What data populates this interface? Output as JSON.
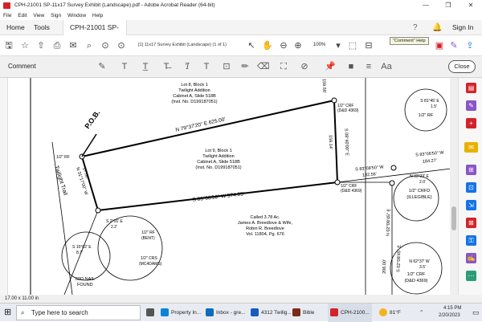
{
  "window": {
    "title": "CPH-21001 SP-11x17 Survey Exhibit (Landscape).pdf - Adobe Acrobat Reader (64-bit)",
    "minimize": "—",
    "maximize": "❐",
    "close": "✕"
  },
  "menu": [
    "File",
    "Edit",
    "View",
    "Sign",
    "Window",
    "Help"
  ],
  "tabs": {
    "home": "Home",
    "tools": "Tools",
    "doc": "CPH-21001 SP-11x...",
    "doc_close": "×",
    "sign_in": "Sign In"
  },
  "toolbar": {
    "page_info": "[1] 11x17 Survey Exhibit (Landscape)  (1 of 1)",
    "zoom": "100%"
  },
  "tooltip": "\"Comment\" Help",
  "comment_bar": {
    "label": "Comment",
    "close": "Close"
  },
  "status": {
    "size": "17.00 x 11.00 in"
  },
  "taskbar": {
    "search_placeholder": "Type here to search",
    "items": [
      "Property In...",
      "Inbox - gre...",
      "4312 Twilig...",
      "Bible",
      "CPH-2100..."
    ],
    "temp": "81°F",
    "time": "4:15 PM",
    "date": "2/20/2023"
  },
  "colors": {
    "accent": "#1473e6",
    "acrobat_red": "#d2232a",
    "comment_icon": "#e8b100",
    "taskbar": "#e8ecf2"
  },
  "drawing": {
    "lot8": [
      "Lot 8, Block 1",
      "Twilight Addition",
      "Cabinet A, Slide 518B",
      "(Inst. No. D199187051)"
    ],
    "lot9": [
      "Lot 9, Block 1",
      "Twilight Addition",
      "Cabinet A, Slide 518B",
      "(Inst. No. D199187051)"
    ],
    "called": [
      "Called 3.78 Ac.",
      "James A. Breedlove & Wife,",
      "Robin R. Breedlove",
      "Vol. 11804, Pg. 676"
    ],
    "north_bearing": "N 79°37'20\" E   625.00'",
    "south_bearing": "S 83°08'50\" W   574.05'",
    "east_bearing": "S 08°40'00\" E",
    "east_dist": "159.14'",
    "top_dist": "159.56'",
    "right_bearing1": "S 83°08'50\" W",
    "right_dist1": "132.56'",
    "right_bearing2": "S 83°06'50\" W",
    "right_dist2": "184.27'",
    "pob": "P.O.B.",
    "crf_top": "1/2\" CRF",
    "crf_top_sub": "(D&D 4369)",
    "crf_mid": "1/2\" CRF",
    "crf_mid_sub": "(D&D 4369)",
    "rf_left": "1/2\" RF",
    "twilight_trail": "Twilight Trail",
    "left_bearing": "N 31°17'00\" W",
    "left_dist": "17.50'",
    "circ1": [
      "S 81°45' E",
      "1.5'",
      "1/2\" RF"
    ],
    "circ2": [
      "N 33°23' E",
      "2.0'",
      "1/2\" CRFD",
      "(ILLEGIBLE)"
    ],
    "circ3": [
      "N 62°37' W",
      "3.5'",
      "1/2\" CRF",
      "(D&D 4369)"
    ],
    "circ4": [
      "S 2°16' E",
      "2.2'",
      "1/2\" RF",
      "(BENT)",
      "1/2\" CRS",
      "(MC4DAMS)"
    ],
    "circ5": [
      "S 15°02' E",
      "8.7'",
      "60D NAIL",
      "FOUND"
    ],
    "right_vertical1": "N 02°08'45\" E",
    "right_vertical2": "S 02°08'45\" E",
    "right_vertical_dist": "206.00'"
  }
}
